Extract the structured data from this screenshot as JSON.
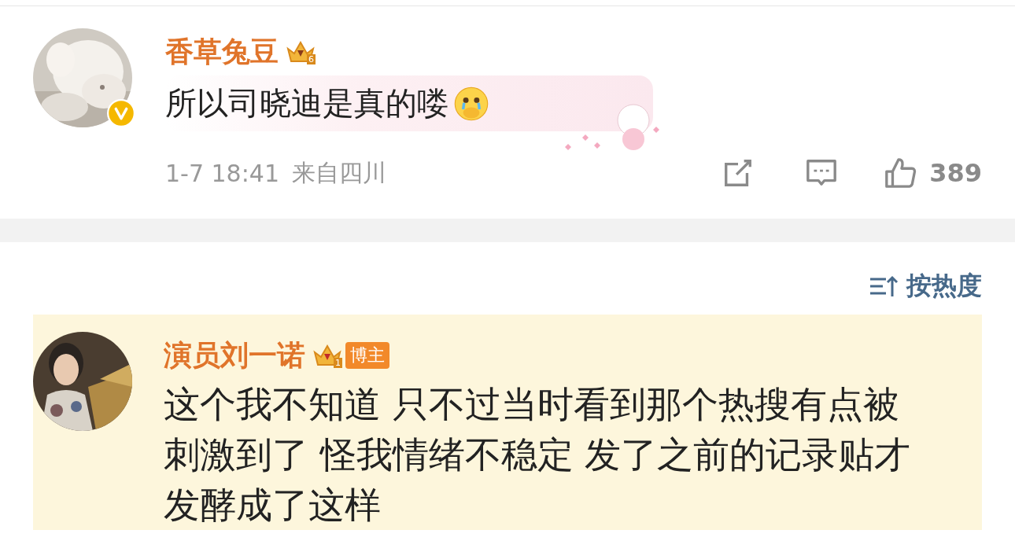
{
  "comments": [
    {
      "author": "香草兔豆",
      "badge_level": "6",
      "verified": true,
      "text": "所以司晓迪是真的喽",
      "bubble": true,
      "meta": {
        "time": "1-7 18:41",
        "location": "来自四川"
      },
      "likes": "389"
    }
  ],
  "sort": {
    "label": "按热度"
  },
  "replies": [
    {
      "kind": "highlighted",
      "author": "演员刘一诺",
      "badge_level": "1",
      "tag": "博主",
      "text_lines": [
        "这个我不知道 只不过当时看到那个热搜有点被",
        "刺激到了 怪我情绪不稳定 发了之前的记录贴才",
        "发酵成了这样"
      ]
    }
  ]
}
